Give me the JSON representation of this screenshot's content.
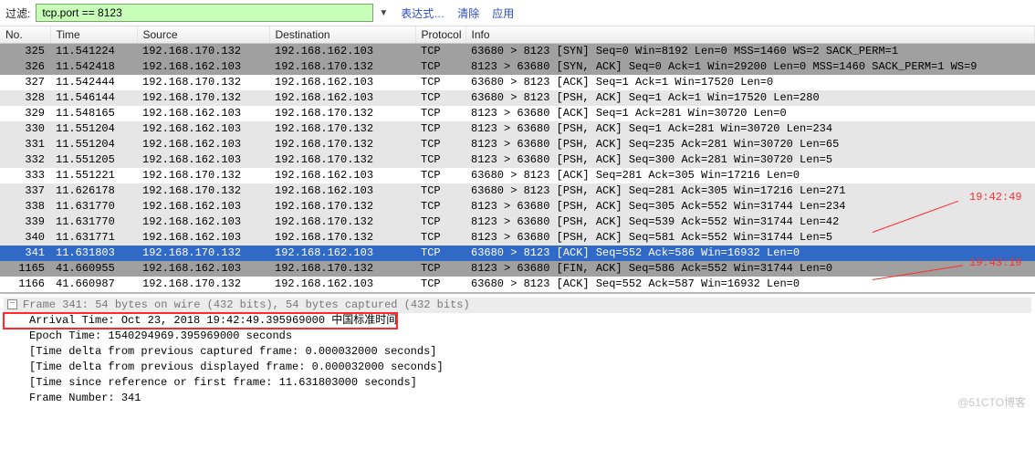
{
  "toolbar": {
    "filter_label": "过滤:",
    "filter_value": "tcp.port == 8123",
    "expr_label": "表达式…",
    "clear_label": "清除",
    "apply_label": "应用"
  },
  "columns": {
    "no": "No.",
    "time": "Time",
    "source": "Source",
    "destination": "Destination",
    "protocol": "Protocol",
    "info": "Info"
  },
  "packets": [
    {
      "row": "gray",
      "no": "325",
      "time": "11.541224",
      "src": "192.168.170.132",
      "dst": "192.168.162.103",
      "proto": "TCP",
      "info": "63680 > 8123 [SYN] Seq=0 Win=8192 Len=0 MSS=1460 WS=2 SACK_PERM=1"
    },
    {
      "row": "gray",
      "no": "326",
      "time": "11.542418",
      "src": "192.168.162.103",
      "dst": "192.168.170.132",
      "proto": "TCP",
      "info": "8123 > 63680 [SYN, ACK] Seq=0 Ack=1 Win=29200 Len=0 MSS=1460 SACK_PERM=1 WS=9"
    },
    {
      "row": "plain",
      "no": "327",
      "time": "11.542444",
      "src": "192.168.170.132",
      "dst": "192.168.162.103",
      "proto": "TCP",
      "info": "63680 > 8123 [ACK] Seq=1 Ack=1 Win=17520 Len=0"
    },
    {
      "row": "light",
      "no": "328",
      "time": "11.546144",
      "src": "192.168.170.132",
      "dst": "192.168.162.103",
      "proto": "TCP",
      "info": "63680 > 8123 [PSH, ACK] Seq=1 Ack=1 Win=17520 Len=280"
    },
    {
      "row": "plain",
      "no": "329",
      "time": "11.548165",
      "src": "192.168.162.103",
      "dst": "192.168.170.132",
      "proto": "TCP",
      "info": "8123 > 63680 [ACK] Seq=1 Ack=281 Win=30720 Len=0"
    },
    {
      "row": "light",
      "no": "330",
      "time": "11.551204",
      "src": "192.168.162.103",
      "dst": "192.168.170.132",
      "proto": "TCP",
      "info": "8123 > 63680 [PSH, ACK] Seq=1 Ack=281 Win=30720 Len=234"
    },
    {
      "row": "light",
      "no": "331",
      "time": "11.551204",
      "src": "192.168.162.103",
      "dst": "192.168.170.132",
      "proto": "TCP",
      "info": "8123 > 63680 [PSH, ACK] Seq=235 Ack=281 Win=30720 Len=65"
    },
    {
      "row": "light",
      "no": "332",
      "time": "11.551205",
      "src": "192.168.162.103",
      "dst": "192.168.170.132",
      "proto": "TCP",
      "info": "8123 > 63680 [PSH, ACK] Seq=300 Ack=281 Win=30720 Len=5"
    },
    {
      "row": "plain",
      "no": "333",
      "time": "11.551221",
      "src": "192.168.170.132",
      "dst": "192.168.162.103",
      "proto": "TCP",
      "info": "63680 > 8123 [ACK] Seq=281 Ack=305 Win=17216 Len=0"
    },
    {
      "row": "light",
      "no": "337",
      "time": "11.626178",
      "src": "192.168.170.132",
      "dst": "192.168.162.103",
      "proto": "TCP",
      "info": "63680 > 8123 [PSH, ACK] Seq=281 Ack=305 Win=17216 Len=271"
    },
    {
      "row": "light",
      "no": "338",
      "time": "11.631770",
      "src": "192.168.162.103",
      "dst": "192.168.170.132",
      "proto": "TCP",
      "info": "8123 > 63680 [PSH, ACK] Seq=305 Ack=552 Win=31744 Len=234"
    },
    {
      "row": "light",
      "no": "339",
      "time": "11.631770",
      "src": "192.168.162.103",
      "dst": "192.168.170.132",
      "proto": "TCP",
      "info": "8123 > 63680 [PSH, ACK] Seq=539 Ack=552 Win=31744 Len=42"
    },
    {
      "row": "light",
      "no": "340",
      "time": "11.631771",
      "src": "192.168.162.103",
      "dst": "192.168.170.132",
      "proto": "TCP",
      "info": "8123 > 63680 [PSH, ACK] Seq=581 Ack=552 Win=31744 Len=5"
    },
    {
      "row": "sel",
      "no": "341",
      "time": "11.631803",
      "src": "192.168.170.132",
      "dst": "192.168.162.103",
      "proto": "TCP",
      "info": "63680 > 8123 [ACK] Seq=552 Ack=586 Win=16932 Len=0"
    },
    {
      "row": "gray",
      "no": "1165",
      "time": "41.660955",
      "src": "192.168.162.103",
      "dst": "192.168.170.132",
      "proto": "TCP",
      "info": "8123 > 63680 [FIN, ACK] Seq=586 Ack=552 Win=31744 Len=0"
    },
    {
      "row": "plain",
      "no": "1166",
      "time": "41.660987",
      "src": "192.168.170.132",
      "dst": "192.168.162.103",
      "proto": "TCP",
      "info": "63680 > 8123 [ACK] Seq=552 Ack=587 Win=16932 Len=0"
    }
  ],
  "annotations": {
    "t1": "19:42:49",
    "t2": "19:43:19"
  },
  "details": {
    "header": "Frame 341: 54 bytes on wire (432 bits), 54 bytes captured (432 bits)",
    "l0": "Arrival Time: Oct 23, 2018 19:42:49.395969000 中国标准时间",
    "l1": "Epoch Time: 1540294969.395969000 seconds",
    "l2": "[Time delta from previous captured frame: 0.000032000 seconds]",
    "l3": "[Time delta from previous displayed frame: 0.000032000 seconds]",
    "l4": "[Time since reference or first frame: 11.631803000 seconds]",
    "l5": "Frame Number: 341"
  },
  "watermark": "@51CTO博客"
}
